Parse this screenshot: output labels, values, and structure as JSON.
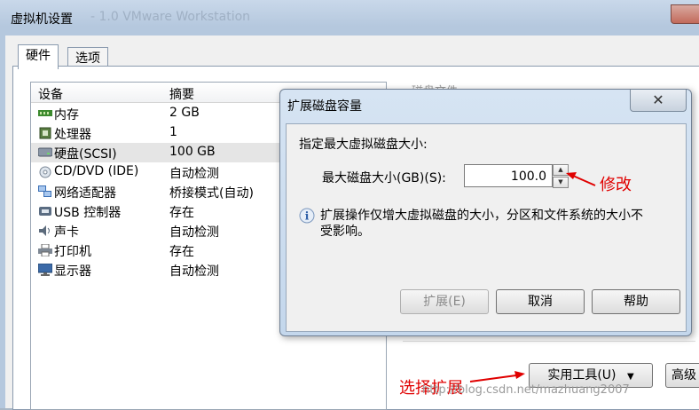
{
  "window": {
    "title": "虚拟机设置",
    "ghost_title": "- 1.0 VMware Workstation"
  },
  "tabs": [
    {
      "label": "硬件"
    },
    {
      "label": "选项"
    }
  ],
  "devices": {
    "col_device": "设备",
    "col_summary": "摘要",
    "items": [
      {
        "name": "内存",
        "summary": "2 GB",
        "icon": "memory-icon"
      },
      {
        "name": "处理器",
        "summary": "1",
        "icon": "processor-icon"
      },
      {
        "name": "硬盘(SCSI)",
        "summary": "100 GB",
        "icon": "harddisk-icon"
      },
      {
        "name": "CD/DVD (IDE)",
        "summary": "自动检测",
        "icon": "cdrom-icon"
      },
      {
        "name": "网络适配器",
        "summary": "桥接模式(自动)",
        "icon": "network-icon"
      },
      {
        "name": "USB 控制器",
        "summary": "存在",
        "icon": "usb-icon"
      },
      {
        "name": "声卡",
        "summary": "自动检测",
        "icon": "sound-icon"
      },
      {
        "name": "打印机",
        "summary": "存在",
        "icon": "printer-icon"
      },
      {
        "name": "显示器",
        "summary": "自动检测",
        "icon": "display-icon"
      }
    ]
  },
  "right_panel": {
    "ghost_label": "磁盘文件"
  },
  "bottom": {
    "utilities_label": "实用工具(U)",
    "advanced_label": "高级"
  },
  "dialog": {
    "title": "扩展磁盘容量",
    "prompt": "指定最大虚拟磁盘大小:",
    "size_label": "最大磁盘大小(GB)(S):",
    "size_value": "100.0",
    "info_line1": "扩展操作仅增大虚拟磁盘的大小，分区和文件系统的大小不",
    "info_line2": "受影响。",
    "expand_label": "扩展(E)",
    "cancel_label": "取消",
    "help_label": "帮助"
  },
  "annotations": {
    "modify": "修改",
    "select_expand": "选择扩展",
    "watermark": "http://blog.csdn.net/mazhuang2007"
  },
  "colors": {
    "annotation": "#e00000",
    "selected_row": "#e5e5e5"
  }
}
